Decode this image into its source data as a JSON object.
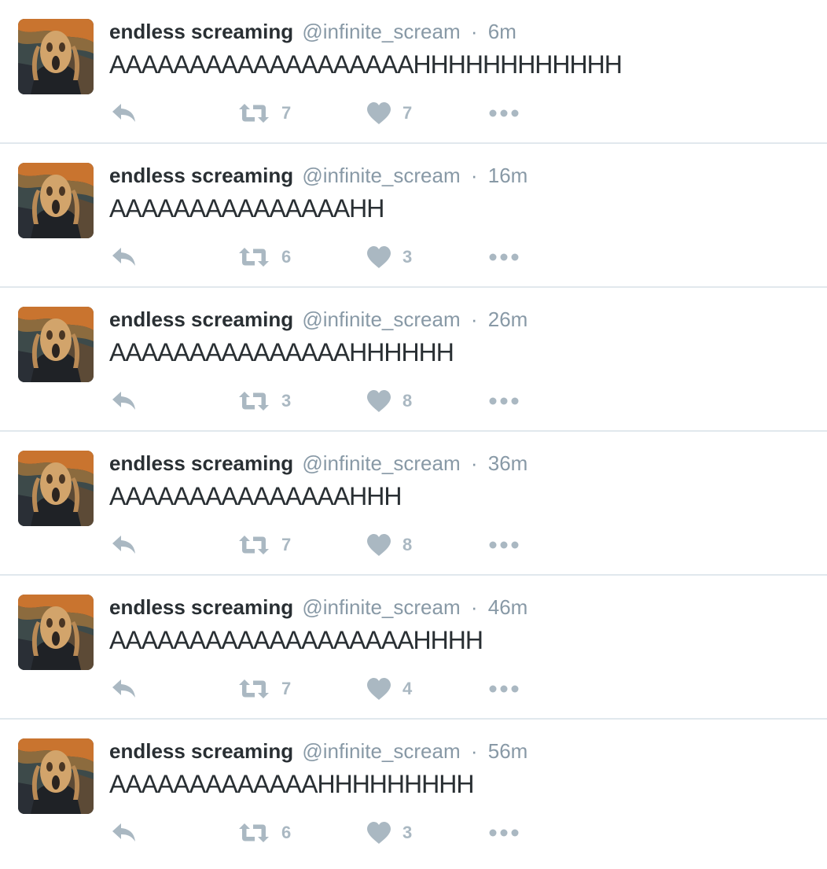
{
  "timeline": {
    "tweets": [
      {
        "display_name": "endless screaming",
        "handle": "@infinite_scream",
        "separator": "·",
        "time": "6m",
        "text": "AAAAAAAAAAAAAAAAAAAHHHHHHHHHHHH",
        "retweets": "7",
        "likes": "7"
      },
      {
        "display_name": "endless screaming",
        "handle": "@infinite_scream",
        "separator": "·",
        "time": "16m",
        "text": "AAAAAAAAAAAAAAAHH",
        "retweets": "6",
        "likes": "3"
      },
      {
        "display_name": "endless screaming",
        "handle": "@infinite_scream",
        "separator": "·",
        "time": "26m",
        "text": "AAAAAAAAAAAAAAAHHHHHH",
        "retweets": "3",
        "likes": "8"
      },
      {
        "display_name": "endless screaming",
        "handle": "@infinite_scream",
        "separator": "·",
        "time": "36m",
        "text": "AAAAAAAAAAAAAAAHHH",
        "retweets": "7",
        "likes": "8"
      },
      {
        "display_name": "endless screaming",
        "handle": "@infinite_scream",
        "separator": "·",
        "time": "46m",
        "text": "AAAAAAAAAAAAAAAAAAAHHHH",
        "retweets": "7",
        "likes": "4"
      },
      {
        "display_name": "endless screaming",
        "handle": "@infinite_scream",
        "separator": "·",
        "time": "56m",
        "text": "AAAAAAAAAAAAAHHHHHHHHH",
        "retweets": "6",
        "likes": "3"
      }
    ]
  },
  "colors": {
    "name": "#292f33",
    "secondary": "#8899a6",
    "action_icon": "#aab8c2",
    "divider": "#e1e8ed"
  },
  "icons": {
    "avatar": "the-scream-painting",
    "reply": "reply-icon",
    "retweet": "retweet-icon",
    "like": "heart-icon",
    "more": "more-icon"
  }
}
